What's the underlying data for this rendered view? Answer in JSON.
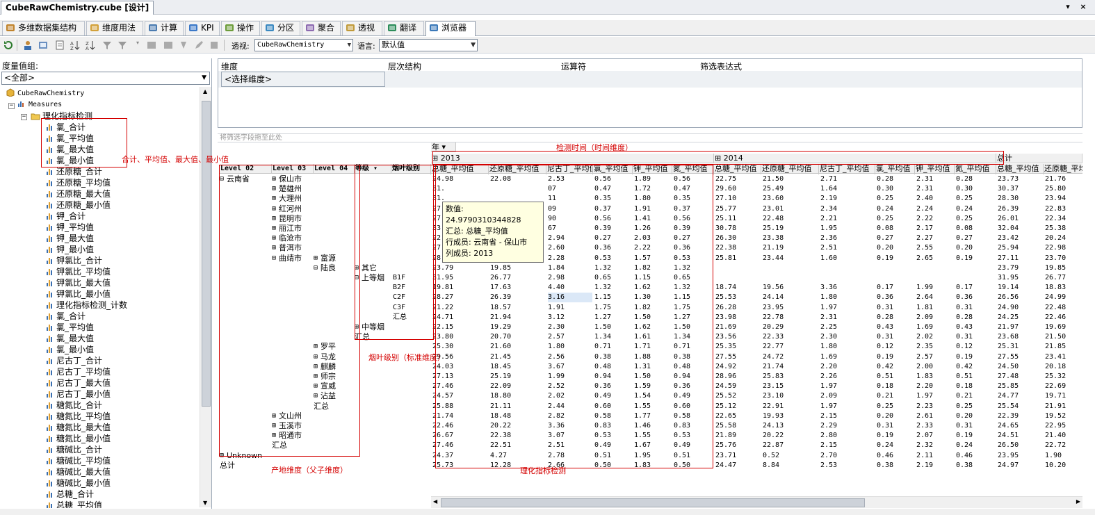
{
  "window": {
    "doc_tab": "CubeRawChemistry.cube [设计]",
    "pin": "▾",
    "close": "×"
  },
  "tabs": [
    "多维数据集结构",
    "维度用法",
    "计算",
    "KPI",
    "操作",
    "分区",
    "聚合",
    "透视",
    "翻译",
    "浏览器"
  ],
  "toolbar": {
    "perspective_label": "透视:",
    "perspective_value": "CubeRawChemistry",
    "language_label": "语言:",
    "language_value": "默认值"
  },
  "left": {
    "measure_group_label": "度量值组:",
    "measure_group_value": "<全部>"
  },
  "tree": {
    "root": "CubeRawChemistry",
    "measures": "Measures",
    "folder": "理化指标检测",
    "items": [
      "氯_合计",
      "氯_平均值",
      "氯_最大值",
      "氯_最小值",
      "还原糖_合计",
      "还原糖_平均值",
      "还原糖_最大值",
      "还原糖_最小值",
      "钾_合计",
      "钾_平均值",
      "钾_最大值",
      "钾_最小值",
      "钾氯比_合计",
      "钾氯比_平均值",
      "钾氯比_最大值",
      "钾氯比_最小值",
      "理化指标检测_计数",
      "氯_合计",
      "氯_平均值",
      "氯_最大值",
      "氯_最小值",
      "尼古丁_合计",
      "尼古丁_平均值",
      "尼古丁_最大值",
      "尼古丁_最小值",
      "糖氮比_合计",
      "糖氮比_平均值",
      "糖氮比_最大值",
      "糖氮比_最小值",
      "糖碱比_合计",
      "糖碱比_平均值",
      "糖碱比_最大值",
      "糖碱比_最小值",
      "总糖_合计",
      "总糖_平均值"
    ]
  },
  "filter": {
    "headers": [
      "维度",
      "层次结构",
      "运算符",
      "筛选表达式"
    ],
    "select_dim": "<选择维度>",
    "drop_hint": "将筛选字段拖至此处"
  },
  "grid": {
    "year_label": "年",
    "years": [
      "2013",
      "2014",
      "总计"
    ],
    "row_headers": [
      "Level 02",
      "Level 03",
      "Level 04",
      "等级",
      "烟叶级别"
    ],
    "col_headers": [
      "总糖_平均值",
      "还原糖_平均值",
      "尼古丁_平均值",
      "氯_平均值",
      "钾_平均值",
      "氮_平均值",
      "总糖_平均值",
      "还原糖_平均值",
      "尼古丁_平均值",
      "氯_平均值",
      "钾_平均值",
      "氮_平均值",
      "总糖_平均值",
      "还原糖_平均值"
    ],
    "rows": [
      {
        "l2": "云南省",
        "l3": "保山市",
        "v": [
          "24.98",
          "22.08",
          "2.53",
          "0.56",
          "1.89",
          "0.56",
          "22.75",
          "21.50",
          "2.71",
          "0.28",
          "2.31",
          "0.28",
          "23.73",
          "21.76"
        ]
      },
      {
        "l3": "楚雄州",
        "v": [
          "31.",
          "",
          "07",
          "0.47",
          "1.72",
          "0.47",
          "29.60",
          "25.49",
          "1.64",
          "0.30",
          "2.31",
          "0.30",
          "30.37",
          "25.80"
        ]
      },
      {
        "l3": "大理州",
        "v": [
          "31.",
          "",
          "11",
          "0.35",
          "1.80",
          "0.35",
          "27.10",
          "23.60",
          "2.19",
          "0.25",
          "2.40",
          "0.25",
          "28.30",
          "23.94"
        ]
      },
      {
        "l3": "红河州",
        "v": [
          "27.",
          "",
          "09",
          "0.37",
          "1.91",
          "0.37",
          "25.77",
          "23.01",
          "2.34",
          "0.24",
          "2.24",
          "0.24",
          "26.39",
          "22.83"
        ]
      },
      {
        "l3": "昆明市",
        "v": [
          "27.",
          "",
          "90",
          "0.56",
          "1.41",
          "0.56",
          "25.11",
          "22.48",
          "2.21",
          "0.25",
          "2.22",
          "0.25",
          "26.01",
          "22.34"
        ]
      },
      {
        "l3": "丽江市",
        "v": [
          "33.",
          "",
          "67",
          "0.39",
          "1.26",
          "0.39",
          "30.78",
          "25.19",
          "1.95",
          "0.08",
          "2.17",
          "0.08",
          "32.04",
          "25.38"
        ]
      },
      {
        "l3": "临沧市",
        "v": [
          "22.02",
          "18.71",
          "2.94",
          "0.27",
          "2.03",
          "0.27",
          "26.30",
          "23.38",
          "2.36",
          "0.27",
          "2.27",
          "0.27",
          "23.42",
          "20.24"
        ]
      },
      {
        "l3": "普洱市",
        "v": [
          "27.34",
          "23.69",
          "2.60",
          "0.36",
          "2.22",
          "0.36",
          "22.38",
          "21.19",
          "2.51",
          "0.20",
          "2.55",
          "0.20",
          "25.94",
          "22.98"
        ]
      },
      {
        "l3": "曲靖市",
        "l4": "富源",
        "v": [
          "28.64",
          "24.01",
          "2.28",
          "0.53",
          "1.57",
          "0.53",
          "25.81",
          "23.44",
          "1.60",
          "0.19",
          "2.65",
          "0.19",
          "27.11",
          "23.70"
        ]
      },
      {
        "l4": "陆良",
        "lv": "其它",
        "v": [
          "23.79",
          "19.85",
          "1.84",
          "1.32",
          "1.82",
          "1.32",
          "",
          "",
          "",
          "",
          "",
          "",
          "23.79",
          "19.85"
        ]
      },
      {
        "lv": "上等烟",
        "g": "B1F",
        "v": [
          "31.95",
          "26.77",
          "2.98",
          "0.65",
          "1.15",
          "0.65",
          "",
          "",
          "",
          "",
          "",
          "",
          "31.95",
          "26.77"
        ]
      },
      {
        "g": "B2F",
        "v": [
          "19.81",
          "17.63",
          "4.40",
          "1.32",
          "1.62",
          "1.32",
          "18.74",
          "19.56",
          "3.36",
          "0.17",
          "1.99",
          "0.17",
          "19.14",
          "18.83"
        ]
      },
      {
        "g": "C2F",
        "v": [
          "28.27",
          "26.39",
          "3.16",
          "1.15",
          "1.30",
          "1.15",
          "25.53",
          "24.14",
          "1.80",
          "0.36",
          "2.64",
          "0.36",
          "26.56",
          "24.99"
        ]
      },
      {
        "g": "C3F",
        "v": [
          "21.22",
          "18.57",
          "1.91",
          "1.75",
          "1.82",
          "1.75",
          "26.28",
          "23.95",
          "1.97",
          "0.31",
          "1.81",
          "0.31",
          "24.90",
          "22.48"
        ]
      },
      {
        "g": "汇总",
        "v": [
          "24.71",
          "21.94",
          "3.12",
          "1.27",
          "1.50",
          "1.27",
          "23.98",
          "22.78",
          "2.31",
          "0.28",
          "2.09",
          "0.28",
          "24.25",
          "22.46"
        ]
      },
      {
        "lv": "中等烟",
        "v": [
          "22.15",
          "19.29",
          "2.30",
          "1.50",
          "1.62",
          "1.50",
          "21.69",
          "20.29",
          "2.25",
          "0.43",
          "1.69",
          "0.43",
          "21.97",
          "19.69"
        ]
      },
      {
        "lv": "汇总",
        "v": [
          "23.80",
          "20.70",
          "2.57",
          "1.34",
          "1.61",
          "1.34",
          "23.56",
          "22.33",
          "2.30",
          "0.31",
          "2.02",
          "0.31",
          "23.68",
          "21.50"
        ]
      },
      {
        "l4": "罗平",
        "v": [
          "25.30",
          "21.60",
          "1.80",
          "0.71",
          "1.71",
          "0.71",
          "25.35",
          "22.77",
          "1.80",
          "0.12",
          "2.35",
          "0.12",
          "25.31",
          "21.85"
        ]
      },
      {
        "l4": "马龙",
        "v": [
          "29.56",
          "21.45",
          "2.56",
          "0.38",
          "1.88",
          "0.38",
          "27.55",
          "24.72",
          "1.69",
          "0.19",
          "2.57",
          "0.19",
          "27.55",
          "23.41"
        ]
      },
      {
        "l4": "麒麟",
        "v": [
          "24.03",
          "18.45",
          "3.67",
          "0.48",
          "1.31",
          "0.48",
          "24.92",
          "21.74",
          "2.20",
          "0.42",
          "2.00",
          "0.42",
          "24.50",
          "20.18"
        ]
      },
      {
        "l4": "师宗",
        "v": [
          "27.13",
          "25.19",
          "1.99",
          "0.94",
          "1.50",
          "0.94",
          "28.96",
          "25.83",
          "2.26",
          "0.51",
          "1.83",
          "0.51",
          "27.48",
          "25.32"
        ]
      },
      {
        "l4": "宣威",
        "v": [
          "27.46",
          "22.09",
          "2.52",
          "0.36",
          "1.59",
          "0.36",
          "24.59",
          "23.15",
          "1.97",
          "0.18",
          "2.20",
          "0.18",
          "25.85",
          "22.69"
        ]
      },
      {
        "l4": "沾益",
        "v": [
          "24.57",
          "18.80",
          "2.02",
          "0.49",
          "1.54",
          "0.49",
          "25.52",
          "23.10",
          "2.09",
          "0.21",
          "1.97",
          "0.21",
          "24.77",
          "19.71"
        ]
      },
      {
        "l4": "汇总",
        "v": [
          "25.88",
          "21.11",
          "2.44",
          "0.60",
          "1.55",
          "0.60",
          "25.12",
          "22.91",
          "1.97",
          "0.25",
          "2.23",
          "0.25",
          "25.54",
          "21.91"
        ]
      },
      {
        "l3": "文山州",
        "v": [
          "21.74",
          "18.48",
          "2.82",
          "0.58",
          "1.77",
          "0.58",
          "22.65",
          "19.93",
          "2.15",
          "0.20",
          "2.61",
          "0.20",
          "22.39",
          "19.52"
        ]
      },
      {
        "l3": "玉溪市",
        "v": [
          "22.46",
          "20.22",
          "3.36",
          "0.83",
          "1.46",
          "0.83",
          "25.58",
          "24.13",
          "2.29",
          "0.31",
          "2.33",
          "0.31",
          "24.65",
          "22.95"
        ]
      },
      {
        "l3": "昭通市",
        "v": [
          "26.67",
          "22.38",
          "3.07",
          "0.53",
          "1.55",
          "0.53",
          "21.89",
          "20.22",
          "2.80",
          "0.19",
          "2.07",
          "0.19",
          "24.51",
          "21.40"
        ]
      },
      {
        "l3": "汇总",
        "v": [
          "27.46",
          "22.51",
          "2.51",
          "0.49",
          "1.67",
          "0.49",
          "25.76",
          "22.87",
          "2.15",
          "0.24",
          "2.32",
          "0.24",
          "26.50",
          "22.72"
        ]
      },
      {
        "l2": "Unknown",
        "v": [
          "24.37",
          "4.27",
          "2.78",
          "0.51",
          "1.95",
          "0.51",
          "23.71",
          "0.52",
          "2.70",
          "0.46",
          "2.11",
          "0.46",
          "23.95",
          "1.90"
        ]
      },
      {
        "l2": "总计",
        "v": [
          "25.73",
          "12.28",
          "2.66",
          "0.50",
          "1.83",
          "0.50",
          "24.47",
          "8.84",
          "2.53",
          "0.38",
          "2.19",
          "0.38",
          "24.97",
          "10.20"
        ]
      }
    ]
  },
  "tooltip": [
    "数值: 24.9790310344828",
    "汇总: 总糖_平均值",
    "行成员: 云南省 - 保山市",
    "列成员: 2013"
  ],
  "annotations": {
    "measures": "合计、平均值、最大值、最小值",
    "time": "检测时间（时间维度）",
    "grade": "烟叶级别（标准维度）",
    "origin": "产地维度（父子维度）",
    "chem": "理化指标检测"
  },
  "colors": {
    "annotation": "#d40000",
    "selected_cell": "#dbe8f7"
  }
}
